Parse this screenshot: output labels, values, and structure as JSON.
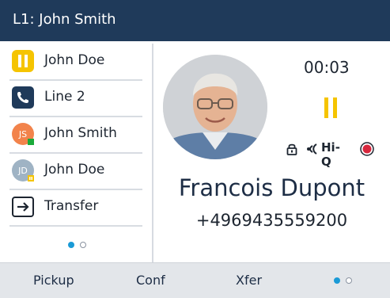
{
  "header": {
    "title": "L1: John Smith"
  },
  "lines": [
    {
      "label": "John Doe",
      "icon": "hold-icon"
    },
    {
      "label": "Line 2",
      "icon": "phone-icon"
    },
    {
      "label": "John Smith",
      "icon": "avatar-js-icon",
      "initials": "JS"
    },
    {
      "label": "John Doe",
      "icon": "avatar-jd-icon",
      "initials": "JD"
    },
    {
      "label": "Transfer",
      "icon": "transfer-icon"
    }
  ],
  "call": {
    "timer": "00:03",
    "hd_label": "Hi-Q",
    "name": "Francois Dupont",
    "number": "+4969435559200"
  },
  "softkeys": {
    "pickup": "Pickup",
    "conf": "Conf",
    "xfer": "Xfer"
  },
  "colors": {
    "header_bg": "#1f3a5a",
    "hold_yellow": "#f5c400",
    "page_dot_active": "#1a9ad6",
    "record_red": "#d7263d"
  }
}
